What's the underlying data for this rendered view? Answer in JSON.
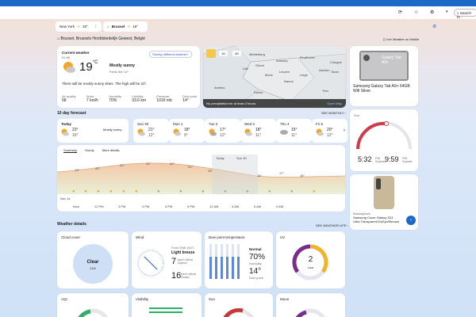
{
  "browser": {
    "search_placeholder": "Search fo"
  },
  "cities": [
    {
      "name": "New York",
      "temp": "20°"
    },
    {
      "name": "Brussel",
      "temp": "19°"
    }
  ],
  "location": {
    "text": "Brussel, Brussels Hoofdstedelijk Gewest, België",
    "live_label": "Live Weather on Mobile"
  },
  "current": {
    "label": "Current weather",
    "time": "01:58",
    "temp": "19",
    "unit": "°C",
    "condition": "Mostly sunny",
    "feels": "Feels like 19°",
    "different": "Seeing different weather?",
    "desc": "There will be mostly sunny skies. The high will be 23°.",
    "stats": [
      {
        "label": "Air quality",
        "value": "58"
      },
      {
        "label": "Wind",
        "value": "7 km/h"
      },
      {
        "label": "Humidity",
        "value": "70%"
      },
      {
        "label": "Visibility",
        "value": "33.6 km"
      },
      {
        "label": "Pressure",
        "value": "1016 mb"
      },
      {
        "label": "Dew point",
        "value": "14°"
      }
    ]
  },
  "map": {
    "tabs": [
      "1D",
      "3D"
    ],
    "cities": [
      "Middelburg",
      "Antwerp",
      "Ghent",
      "Eindhoven",
      "Leuven",
      "Liege",
      "Aachen",
      "Mons",
      "Cologne",
      "Bonn",
      "Namur",
      "Amiens",
      "Lille",
      "Trier",
      "Reims"
    ],
    "no_precip": "No precipitation for at least 2 hours.",
    "open_map": "Open Map"
  },
  "forecast": {
    "title": "10 day forecast",
    "see_monthly": "SEE MONTHLY",
    "days": [
      {
        "name": "Today",
        "hi": "23°",
        "lo": "16°",
        "cond": "Mostly sunny"
      },
      {
        "name": "Sun 30",
        "hi": "21°",
        "lo": "12°"
      },
      {
        "name": "Mon 1",
        "hi": "18°",
        "lo": "9°"
      },
      {
        "name": "Tue 2",
        "hi": "17°",
        "lo": "12°"
      },
      {
        "name": "Wed 3",
        "hi": "18°",
        "lo": "11°"
      },
      {
        "name": "Thu 4",
        "hi": "15°",
        "lo": "11°"
      },
      {
        "name": "Fri 5",
        "hi": "20°",
        "lo": "12°"
      }
    ]
  },
  "hourly": {
    "tabs": [
      "Summary",
      "Hourly",
      "More details"
    ],
    "today_label": "Today",
    "sun_label": "Sun 30",
    "nav_label": "Nov 1k",
    "temps": [
      "19°",
      "20°",
      "22°",
      "22°",
      "22°",
      "21°",
      "19°",
      "16°",
      "17°",
      "16°"
    ],
    "hours": [
      "Now",
      "12 PM",
      "3 PM",
      "4 PM",
      "6 PM",
      "9 PM",
      "12 AM",
      "3 AM",
      "6 AM",
      "9 AM"
    ]
  },
  "promo1": {
    "title": "Samsung Galaxy Tab A9+ 64GB Wifi Silver",
    "badge": "Galaxy Tab A9+"
  },
  "sun_card": {
    "label": "Sun",
    "sunrise": "5:32",
    "sunset": "9:59",
    "rise_lbl": "PM Sunrise",
    "set_lbl": "PM Sunset"
  },
  "promo2": {
    "source": "Marketplace",
    "title": "Samsung Cover Galaxy S24 Ultra Transparent EpSys/Skroutz"
  },
  "details": {
    "title": "Weather details",
    "see": "SEE WEATHER LIFE",
    "cloud": {
      "label": "Cloud cover",
      "value": "Clear",
      "sub": "11%"
    },
    "wind": {
      "label": "Wind",
      "from": "From ENE (94°)",
      "desc": "Light breeze",
      "speed": "7",
      "speed_unit": "km/h Wind Speed",
      "gust": "16",
      "gust_unit": "km/h Wind Gusts"
    },
    "dew": {
      "label": "Dew point temperature",
      "status": "Normal",
      "humidity": "70%",
      "humidity_lbl": "Humidity",
      "dew": "14°",
      "dew_lbl": "Dew point"
    },
    "uv": {
      "label": "UV",
      "value": "2",
      "level": "Low"
    },
    "aqi": {
      "label": "AQI"
    },
    "visibility": {
      "label": "Visibility"
    },
    "sun": {
      "label": "Sun"
    },
    "moon": {
      "label": "Moon"
    }
  }
}
